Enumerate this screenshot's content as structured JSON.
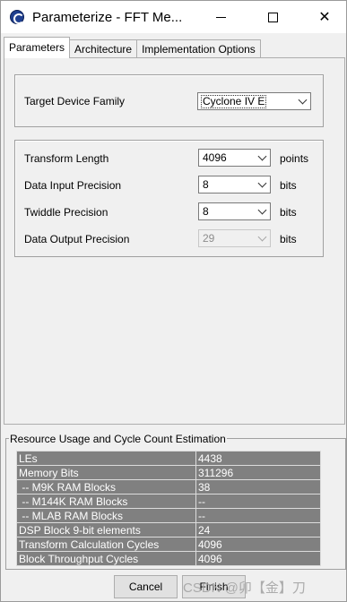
{
  "window": {
    "title": "Parameterize - FFT Me...",
    "controls": {
      "minimize": "minimize-icon",
      "maximize": "maximize-icon",
      "close": "close-icon"
    }
  },
  "tabs": [
    {
      "label": "Parameters",
      "active": true
    },
    {
      "label": "Architecture",
      "active": false
    },
    {
      "label": "Implementation Options",
      "active": false
    }
  ],
  "device": {
    "label": "Target Device Family",
    "value": "Cyclone IV E"
  },
  "params": [
    {
      "label": "Transform Length",
      "value": "4096",
      "unit": "points",
      "enabled": true
    },
    {
      "label": "Data Input Precision",
      "value": "8",
      "unit": "bits",
      "enabled": true
    },
    {
      "label": "Twiddle Precision",
      "value": "8",
      "unit": "bits",
      "enabled": true
    },
    {
      "label": "Data Output Precision",
      "value": "29",
      "unit": "bits",
      "enabled": false
    }
  ],
  "resources": {
    "title": "Resource Usage and Cycle Count Estimation",
    "rows": [
      {
        "name": "LEs",
        "value": "4438"
      },
      {
        "name": "Memory Bits",
        "value": "311296"
      },
      {
        "name": " -- M9K RAM Blocks",
        "value": "38"
      },
      {
        "name": " -- M144K RAM Blocks",
        "value": "--"
      },
      {
        "name": " -- MLAB RAM Blocks",
        "value": "--"
      },
      {
        "name": "DSP Block 9-bit elements",
        "value": "24"
      },
      {
        "name": "Transform Calculation Cycles",
        "value": "4096"
      },
      {
        "name": "Block Throughput Cycles",
        "value": "4096"
      }
    ]
  },
  "buttons": {
    "cancel": "Cancel",
    "finish": "Finish"
  },
  "watermark": "CSDN @卯【金】刀",
  "colors": {
    "table_bg": "#808080",
    "title_bg": "#ffffff",
    "window_bg": "#f0f0f0"
  }
}
